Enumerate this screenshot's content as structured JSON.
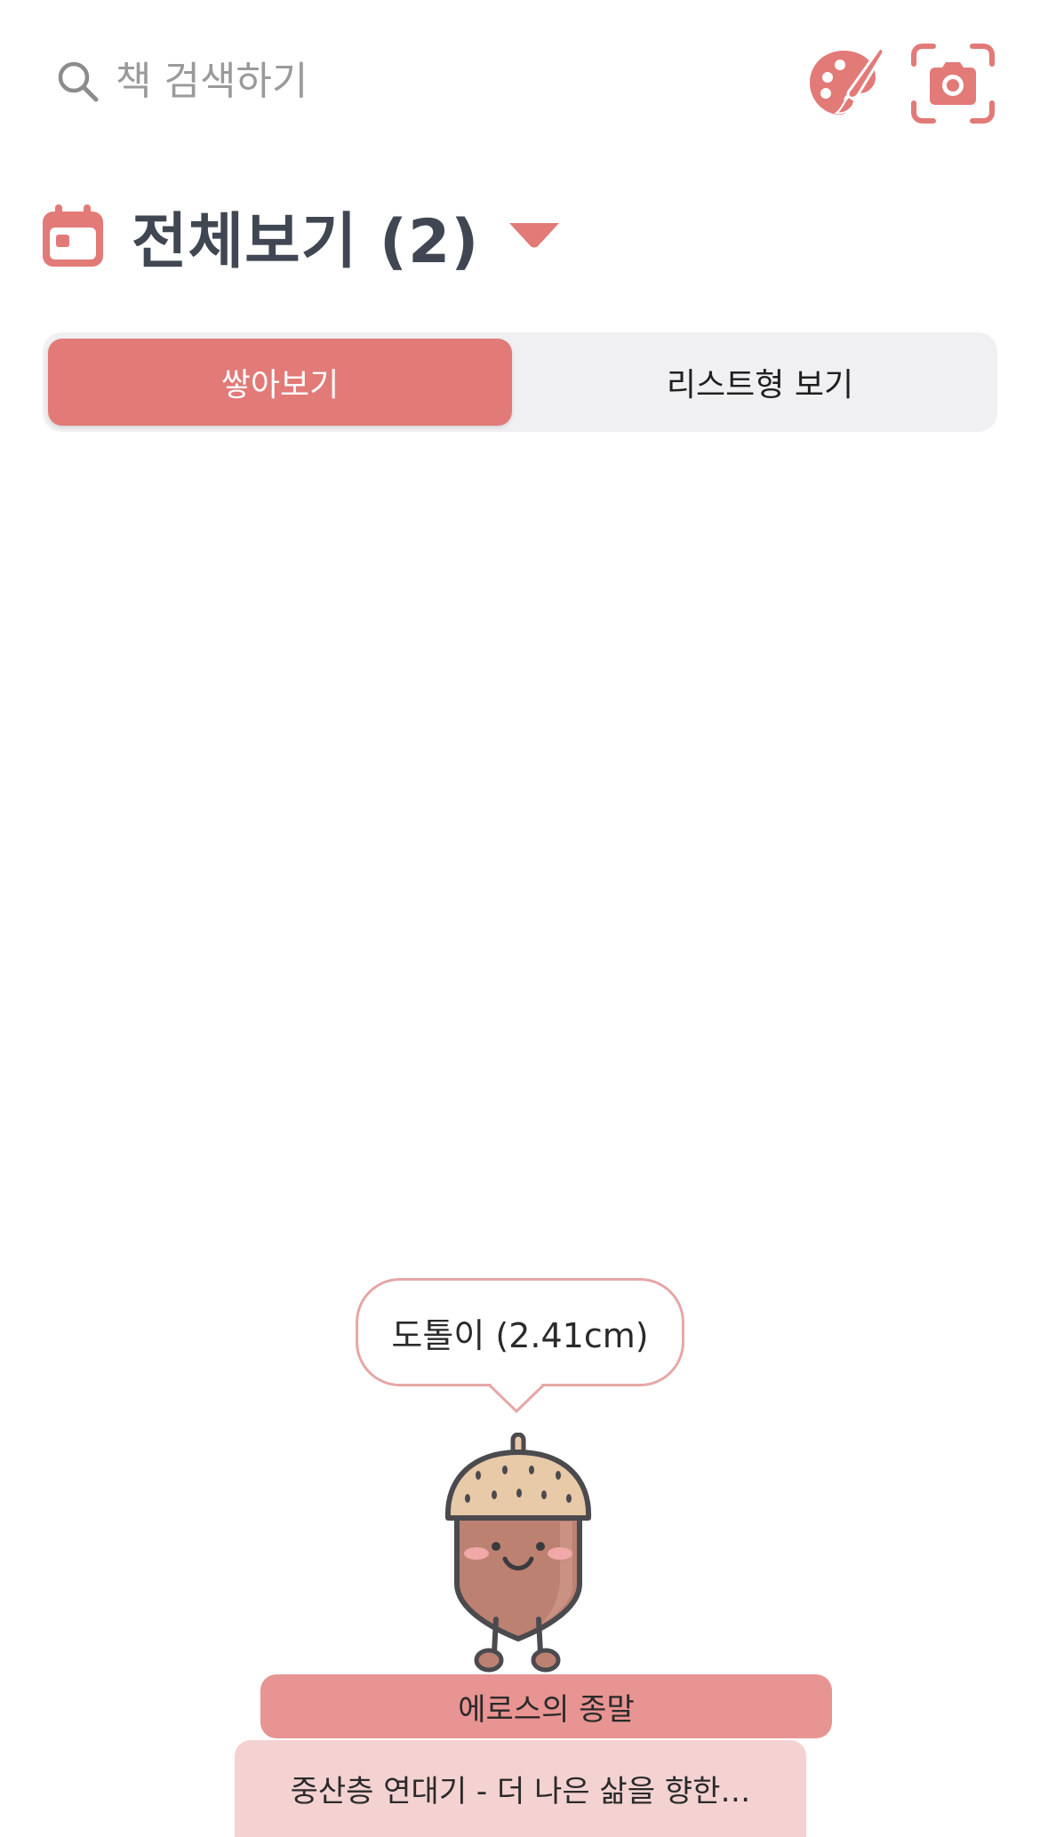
{
  "search": {
    "placeholder": "책 검색하기"
  },
  "header": {
    "title": "전체보기 (2)"
  },
  "view_toggle": {
    "options": [
      {
        "label": "쌓아보기",
        "selected": true
      },
      {
        "label": "리스트형 보기",
        "selected": false
      }
    ]
  },
  "mascot": {
    "bubble_text": "도톨이 (2.41cm)"
  },
  "books": [
    {
      "title": "에로스의 종말"
    },
    {
      "title": "중산층 연대기 - 더 나은 삶을 향한…"
    }
  ],
  "icons": {
    "search": "search-icon",
    "theme": "palette-icon",
    "camera": "camera-scan-icon",
    "calendar": "calendar-icon",
    "dropdown": "caret-down-icon"
  },
  "colors": {
    "accent": "#e27a78",
    "title_text": "#414752",
    "segment_bg": "#f0f0f2",
    "book_primary": "#e79493",
    "book_secondary": "#f4d2d2",
    "bubble_border": "#e6a7a6"
  }
}
